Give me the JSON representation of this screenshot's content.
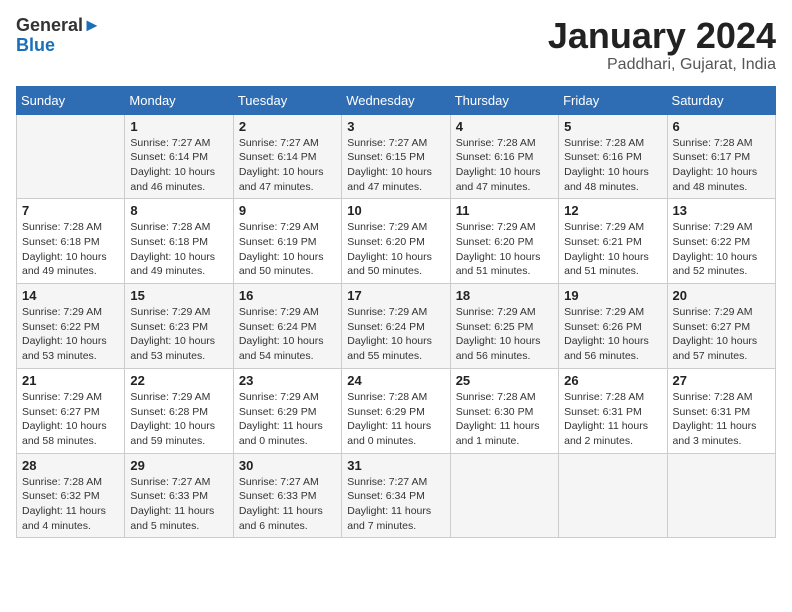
{
  "header": {
    "logo_line1": "General",
    "logo_line2": "Blue",
    "month_title": "January 2024",
    "location": "Paddhari, Gujarat, India"
  },
  "days_of_week": [
    "Sunday",
    "Monday",
    "Tuesday",
    "Wednesday",
    "Thursday",
    "Friday",
    "Saturday"
  ],
  "weeks": [
    [
      {
        "num": "",
        "sunrise": "",
        "sunset": "",
        "daylight": ""
      },
      {
        "num": "1",
        "sunrise": "Sunrise: 7:27 AM",
        "sunset": "Sunset: 6:14 PM",
        "daylight": "Daylight: 10 hours and 46 minutes."
      },
      {
        "num": "2",
        "sunrise": "Sunrise: 7:27 AM",
        "sunset": "Sunset: 6:14 PM",
        "daylight": "Daylight: 10 hours and 47 minutes."
      },
      {
        "num": "3",
        "sunrise": "Sunrise: 7:27 AM",
        "sunset": "Sunset: 6:15 PM",
        "daylight": "Daylight: 10 hours and 47 minutes."
      },
      {
        "num": "4",
        "sunrise": "Sunrise: 7:28 AM",
        "sunset": "Sunset: 6:16 PM",
        "daylight": "Daylight: 10 hours and 47 minutes."
      },
      {
        "num": "5",
        "sunrise": "Sunrise: 7:28 AM",
        "sunset": "Sunset: 6:16 PM",
        "daylight": "Daylight: 10 hours and 48 minutes."
      },
      {
        "num": "6",
        "sunrise": "Sunrise: 7:28 AM",
        "sunset": "Sunset: 6:17 PM",
        "daylight": "Daylight: 10 hours and 48 minutes."
      }
    ],
    [
      {
        "num": "7",
        "sunrise": "Sunrise: 7:28 AM",
        "sunset": "Sunset: 6:18 PM",
        "daylight": "Daylight: 10 hours and 49 minutes."
      },
      {
        "num": "8",
        "sunrise": "Sunrise: 7:28 AM",
        "sunset": "Sunset: 6:18 PM",
        "daylight": "Daylight: 10 hours and 49 minutes."
      },
      {
        "num": "9",
        "sunrise": "Sunrise: 7:29 AM",
        "sunset": "Sunset: 6:19 PM",
        "daylight": "Daylight: 10 hours and 50 minutes."
      },
      {
        "num": "10",
        "sunrise": "Sunrise: 7:29 AM",
        "sunset": "Sunset: 6:20 PM",
        "daylight": "Daylight: 10 hours and 50 minutes."
      },
      {
        "num": "11",
        "sunrise": "Sunrise: 7:29 AM",
        "sunset": "Sunset: 6:20 PM",
        "daylight": "Daylight: 10 hours and 51 minutes."
      },
      {
        "num": "12",
        "sunrise": "Sunrise: 7:29 AM",
        "sunset": "Sunset: 6:21 PM",
        "daylight": "Daylight: 10 hours and 51 minutes."
      },
      {
        "num": "13",
        "sunrise": "Sunrise: 7:29 AM",
        "sunset": "Sunset: 6:22 PM",
        "daylight": "Daylight: 10 hours and 52 minutes."
      }
    ],
    [
      {
        "num": "14",
        "sunrise": "Sunrise: 7:29 AM",
        "sunset": "Sunset: 6:22 PM",
        "daylight": "Daylight: 10 hours and 53 minutes."
      },
      {
        "num": "15",
        "sunrise": "Sunrise: 7:29 AM",
        "sunset": "Sunset: 6:23 PM",
        "daylight": "Daylight: 10 hours and 53 minutes."
      },
      {
        "num": "16",
        "sunrise": "Sunrise: 7:29 AM",
        "sunset": "Sunset: 6:24 PM",
        "daylight": "Daylight: 10 hours and 54 minutes."
      },
      {
        "num": "17",
        "sunrise": "Sunrise: 7:29 AM",
        "sunset": "Sunset: 6:24 PM",
        "daylight": "Daylight: 10 hours and 55 minutes."
      },
      {
        "num": "18",
        "sunrise": "Sunrise: 7:29 AM",
        "sunset": "Sunset: 6:25 PM",
        "daylight": "Daylight: 10 hours and 56 minutes."
      },
      {
        "num": "19",
        "sunrise": "Sunrise: 7:29 AM",
        "sunset": "Sunset: 6:26 PM",
        "daylight": "Daylight: 10 hours and 56 minutes."
      },
      {
        "num": "20",
        "sunrise": "Sunrise: 7:29 AM",
        "sunset": "Sunset: 6:27 PM",
        "daylight": "Daylight: 10 hours and 57 minutes."
      }
    ],
    [
      {
        "num": "21",
        "sunrise": "Sunrise: 7:29 AM",
        "sunset": "Sunset: 6:27 PM",
        "daylight": "Daylight: 10 hours and 58 minutes."
      },
      {
        "num": "22",
        "sunrise": "Sunrise: 7:29 AM",
        "sunset": "Sunset: 6:28 PM",
        "daylight": "Daylight: 10 hours and 59 minutes."
      },
      {
        "num": "23",
        "sunrise": "Sunrise: 7:29 AM",
        "sunset": "Sunset: 6:29 PM",
        "daylight": "Daylight: 11 hours and 0 minutes."
      },
      {
        "num": "24",
        "sunrise": "Sunrise: 7:28 AM",
        "sunset": "Sunset: 6:29 PM",
        "daylight": "Daylight: 11 hours and 0 minutes."
      },
      {
        "num": "25",
        "sunrise": "Sunrise: 7:28 AM",
        "sunset": "Sunset: 6:30 PM",
        "daylight": "Daylight: 11 hours and 1 minute."
      },
      {
        "num": "26",
        "sunrise": "Sunrise: 7:28 AM",
        "sunset": "Sunset: 6:31 PM",
        "daylight": "Daylight: 11 hours and 2 minutes."
      },
      {
        "num": "27",
        "sunrise": "Sunrise: 7:28 AM",
        "sunset": "Sunset: 6:31 PM",
        "daylight": "Daylight: 11 hours and 3 minutes."
      }
    ],
    [
      {
        "num": "28",
        "sunrise": "Sunrise: 7:28 AM",
        "sunset": "Sunset: 6:32 PM",
        "daylight": "Daylight: 11 hours and 4 minutes."
      },
      {
        "num": "29",
        "sunrise": "Sunrise: 7:27 AM",
        "sunset": "Sunset: 6:33 PM",
        "daylight": "Daylight: 11 hours and 5 minutes."
      },
      {
        "num": "30",
        "sunrise": "Sunrise: 7:27 AM",
        "sunset": "Sunset: 6:33 PM",
        "daylight": "Daylight: 11 hours and 6 minutes."
      },
      {
        "num": "31",
        "sunrise": "Sunrise: 7:27 AM",
        "sunset": "Sunset: 6:34 PM",
        "daylight": "Daylight: 11 hours and 7 minutes."
      },
      {
        "num": "",
        "sunrise": "",
        "sunset": "",
        "daylight": ""
      },
      {
        "num": "",
        "sunrise": "",
        "sunset": "",
        "daylight": ""
      },
      {
        "num": "",
        "sunrise": "",
        "sunset": "",
        "daylight": ""
      }
    ]
  ]
}
